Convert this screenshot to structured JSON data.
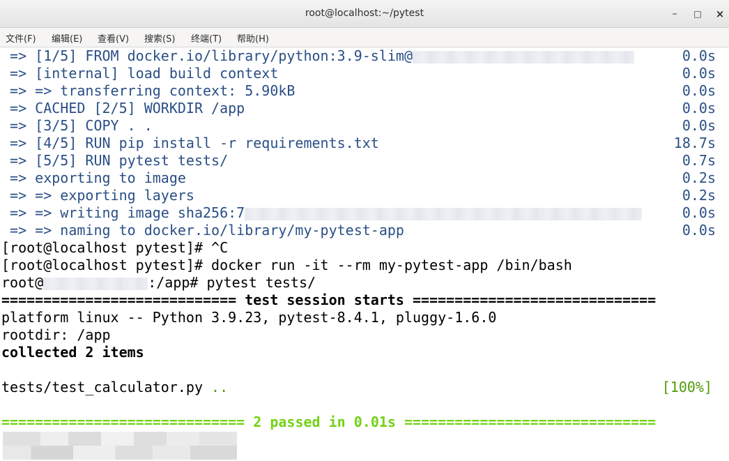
{
  "window": {
    "title": "root@localhost:~/pytest",
    "minimize_label": "–",
    "maximize_label": "□",
    "close_label": "×"
  },
  "menu": {
    "items": [
      {
        "label": "文件(F)"
      },
      {
        "label": "编辑(E)"
      },
      {
        "label": "查看(V)"
      },
      {
        "label": "搜索(S)"
      },
      {
        "label": "终端(T)"
      },
      {
        "label": "帮助(H)"
      }
    ]
  },
  "terminal": {
    "build_steps": [
      {
        "text": " => [1/5] FROM docker.io/library/python:3.9-slim@",
        "time": "0.0s"
      },
      {
        "text": " => [internal] load build context",
        "time": "0.0s"
      },
      {
        "text": " => => transferring context: 5.90kB",
        "time": "0.0s"
      },
      {
        "text": " => CACHED [2/5] WORKDIR /app",
        "time": "0.0s"
      },
      {
        "text": " => [3/5] COPY . .",
        "time": "0.0s"
      },
      {
        "text": " => [4/5] RUN pip install -r requirements.txt",
        "time": "18.7s"
      },
      {
        "text": " => [5/5] RUN pytest tests/",
        "time": "0.7s"
      },
      {
        "text": " => exporting to image",
        "time": "0.2s"
      },
      {
        "text": " => => exporting layers",
        "time": "0.2s"
      },
      {
        "text": " => => writing image sha256:7",
        "time": "0.0s"
      },
      {
        "text": " => => naming to docker.io/library/my-pytest-app",
        "time": "0.0s"
      }
    ],
    "prompt_ctrl_c": "[root@localhost pytest]# ^C",
    "prompt_docker_run": "[root@localhost pytest]# docker run -it --rm my-pytest-app /bin/bash",
    "container_prompt_prefix": "root@",
    "container_prompt_suffix": ":/app# pytest tests/",
    "session_header": "============================ test session starts =============================",
    "platform_line": "platform linux -- Python 3.9.23, pytest-8.4.1, pluggy-1.6.0",
    "rootdir_line": "rootdir: /app",
    "collected_line": "collected 2 items",
    "test_file": "tests/test_calculator.py ",
    "test_dots": "..",
    "progress": "[100%]",
    "summary_left": "============================= ",
    "summary_passed": "2 passed",
    "summary_in": " in ",
    "summary_time": "0.01s",
    "summary_right": " =============================="
  },
  "colors": {
    "build_text": "#2a4f85",
    "pass_green": "#73d216",
    "dot_green": "#4e9a06"
  }
}
